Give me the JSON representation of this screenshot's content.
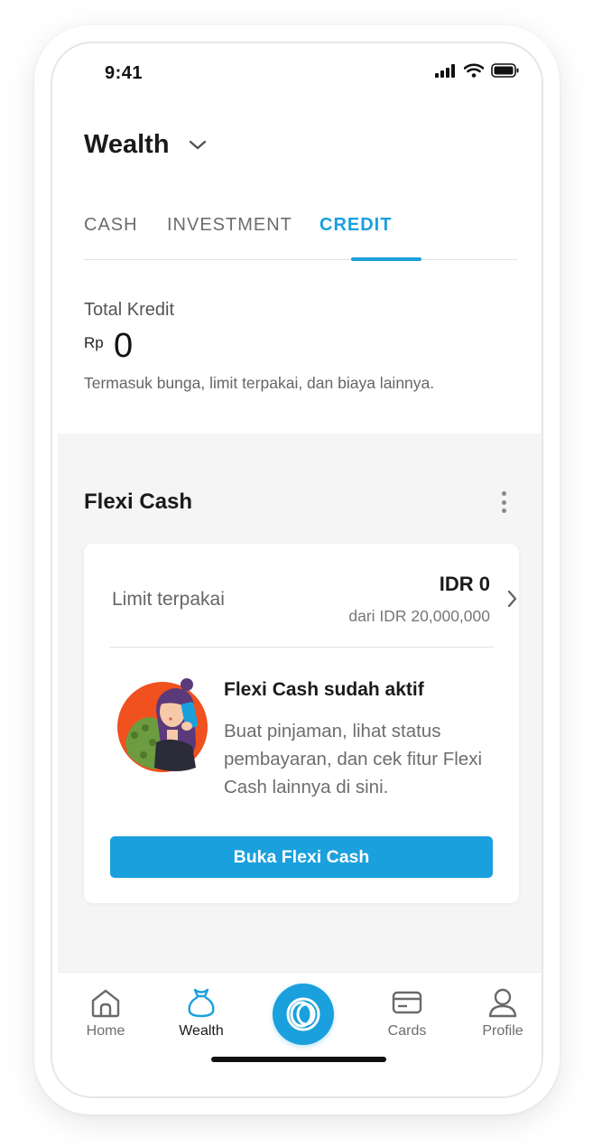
{
  "status_bar": {
    "time": "9:41"
  },
  "header": {
    "title": "Wealth"
  },
  "tabs": [
    {
      "label": "CASH",
      "active": false
    },
    {
      "label": "INVESTMENT",
      "active": false
    },
    {
      "label": "CREDIT",
      "active": true
    }
  ],
  "summary": {
    "label": "Total Kredit",
    "currency": "Rp",
    "amount": "0",
    "note": "Termasuk bunga, limit terpakai, dan biaya lainnya."
  },
  "flexi_cash": {
    "title": "Flexi Cash",
    "limit_label": "Limit terpakai",
    "limit_amount": "IDR 0",
    "limit_total": "dari IDR 20,000,000",
    "promo_title": "Flexi Cash sudah aktif",
    "promo_desc": "Buat pinjaman, lihat status pembayaran, dan cek fitur Flexi Cash lainnya di sini.",
    "cta_label": "Buka Flexi Cash"
  },
  "bottom_nav": [
    {
      "label": "Home",
      "icon": "home-icon",
      "active": false
    },
    {
      "label": "Wealth",
      "icon": "money-bag-icon",
      "active": true
    },
    {
      "label": "Cards",
      "icon": "card-icon",
      "active": false
    },
    {
      "label": "Profile",
      "icon": "user-icon",
      "active": false
    }
  ],
  "colors": {
    "accent": "#1aa0dc",
    "grey_bg": "#f5f5f5",
    "illustration_orange": "#f0511e"
  }
}
